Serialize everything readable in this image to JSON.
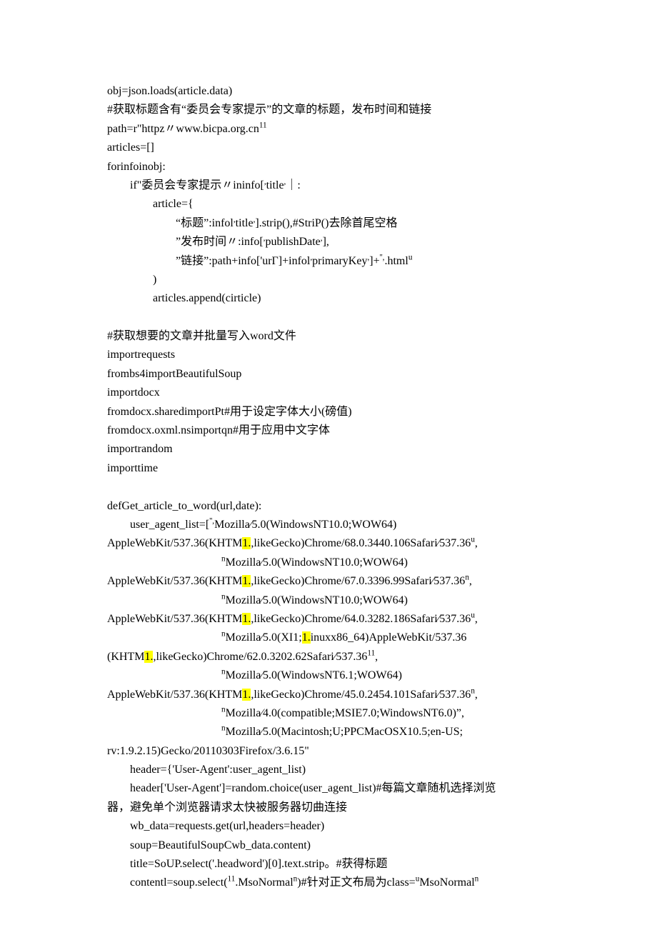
{
  "lines": [
    {
      "t": "obj=json.loads(article"
    },
    {
      "t": ".",
      "u": true
    },
    {
      "t": "data)\n"
    },
    {
      "t": "#获取标题含有“委员会专家提示”的文章的标题，发布时间和链接\n"
    },
    {
      "t": "path=r\"httpz〃www.bicpa.org.cn"
    },
    {
      "t": "11",
      "sup": true
    },
    {
      "t": "\n"
    },
    {
      "t": "articles=[]\n"
    },
    {
      "t": "forinfoinobj:\n"
    },
    {
      "t": "        if\"委员会专家提示〃ininfo["
    },
    {
      "t": ",",
      "sup": true
    },
    {
      "t": "title"
    },
    {
      "t": ",",
      "sup": true
    },
    {
      "t": "｜:\n"
    },
    {
      "t": "                article={\n"
    },
    {
      "t": "                        “标题”:infol"
    },
    {
      "t": ",",
      "sup": true
    },
    {
      "t": "title"
    },
    {
      "t": ",",
      "sup": true
    },
    {
      "t": "].strip(),#StriP()去除首尾空格\n"
    },
    {
      "t": "                        ”发布时间〃:info["
    },
    {
      "t": ",",
      "sup": true
    },
    {
      "t": "publishDate"
    },
    {
      "t": ",",
      "sup": true
    },
    {
      "t": "],\n"
    },
    {
      "t": "                        ”链接”:path+info['urΓ]+infol"
    },
    {
      "t": ",",
      "sup": true
    },
    {
      "t": "primaryKey"
    },
    {
      "t": ",",
      "sup": true
    },
    {
      "t": "]+"
    },
    {
      "t": "'',",
      "sup": true
    },
    {
      "t": ".html"
    },
    {
      "t": "u",
      "sup": true
    },
    {
      "t": "\n"
    },
    {
      "t": "                )\n"
    },
    {
      "t": "                articles.append(cirticle)\n"
    },
    {
      "t": "\n"
    },
    {
      "t": "#获取想要的文章并批量写入word文件\n"
    },
    {
      "t": "importrequests\n"
    },
    {
      "t": "frombs4importBeautifulSoup\n"
    },
    {
      "t": "importdocx\n"
    },
    {
      "t": "fromdocx.sharedimportPt#用于设定字体大小(磅值)\n"
    },
    {
      "t": "fromdocx.oxml.nsimportqn#用于应用中文字体\n"
    },
    {
      "t": "importrandom\n"
    },
    {
      "t": "importtime\n"
    },
    {
      "t": "\n"
    },
    {
      "t": "defGet_article_to_word(url,date):\n"
    },
    {
      "t": "        user_agent_list=["
    },
    {
      "t": "'',",
      "sup": true
    },
    {
      "t": "Mozilla∕5.0(WindowsNT10.0;WOW64)\n"
    },
    {
      "t": "AppleWebKit/537.36(KHTM"
    },
    {
      "t": "1.",
      "hl": true
    },
    {
      "t": ",likeGecko)Chrome/68.0.3440.106Safari∕537.36"
    },
    {
      "t": "u",
      "sup": true
    },
    {
      "t": ",\n"
    },
    {
      "t": "                                        "
    },
    {
      "t": "n",
      "sup": true
    },
    {
      "t": "Mozilla∕5.0(WindowsNT10.0;WOW64)\n"
    },
    {
      "t": "AppleWebKit/537.36(KHTM"
    },
    {
      "t": "1.",
      "hl": true
    },
    {
      "t": ",likeGecko)Chrome/67.0.3396.99Safari∕537.36"
    },
    {
      "t": "n",
      "sup": true
    },
    {
      "t": ",\n"
    },
    {
      "t": "                                        "
    },
    {
      "t": "n",
      "sup": true
    },
    {
      "t": "Mozilla∕5.0(WindowsNT10.0;WOW64)\n"
    },
    {
      "t": "AppleWebKit/537.36(KHTM"
    },
    {
      "t": "1.",
      "hl": true
    },
    {
      "t": ",likeGecko)Chrome/64.0.3282.186Safari∕537.36"
    },
    {
      "t": "u",
      "sup": true
    },
    {
      "t": ",\n"
    },
    {
      "t": "                                        "
    },
    {
      "t": "n",
      "sup": true
    },
    {
      "t": "Mozilla∕5.0(XI1;"
    },
    {
      "t": "1.",
      "hl": true
    },
    {
      "t": "inuxx86_64)AppleWebKit/537.36\n"
    },
    {
      "t": "(KHTM"
    },
    {
      "t": "1.",
      "hl": true
    },
    {
      "t": ",likeGecko)Chrome/62.0.3202.62Safari∕537.36"
    },
    {
      "t": "11",
      "sup": true
    },
    {
      "t": ",\n"
    },
    {
      "t": "                                        "
    },
    {
      "t": "n",
      "sup": true
    },
    {
      "t": "Mozilla∕5.0(WindowsNT6.1;WOW64)\n"
    },
    {
      "t": "AppleWebKit/537.36(KHTM"
    },
    {
      "t": "1.",
      "hl": true
    },
    {
      "t": ",likeGecko)Chrome/45.0.2454.101Safari∕537.36"
    },
    {
      "t": "n",
      "sup": true
    },
    {
      "t": ",\n"
    },
    {
      "t": "                                        "
    },
    {
      "t": "n",
      "sup": true
    },
    {
      "t": "Mozilla∕4.0(compatible;MSIE7.0;WindowsNT6.0)”,\n"
    },
    {
      "t": "                                        "
    },
    {
      "t": "n",
      "sup": true
    },
    {
      "t": "Mozilla∕5.0(Macintosh;U;PPCMacOSX10.5;en-US;\n"
    },
    {
      "t": "rv:1.9.2.15)Gecko/20110303Firefox/3.6.15\"\n"
    },
    {
      "t": "        header={'User-Agent':user_agent_list)\n"
    },
    {
      "t": "        header['User-Agent']=random.choice(user_agent_list)#每篇文章随机选择浏览\n"
    },
    {
      "t": "器，避免单个浏览器请求太快被服务器切曲连接\n"
    },
    {
      "t": "        wb_data=requests.get(url,headers=header)\n"
    },
    {
      "t": "        soup=BeautifulSoupCwb_data.content)\n"
    },
    {
      "t": "        title=SoUP.select('.headword')[0].text.strip。#获得标题\n"
    },
    {
      "t": "        contentl=soup.select("
    },
    {
      "t": "11",
      "sup": true
    },
    {
      "t": ".MsoNormal"
    },
    {
      "t": "n",
      "sup": true
    },
    {
      "t": ")#针对正文布局为class="
    },
    {
      "t": "u",
      "sup": true
    },
    {
      "t": "MsoNormal"
    },
    {
      "t": "n",
      "sup": true
    },
    {
      "t": "\n"
    }
  ]
}
